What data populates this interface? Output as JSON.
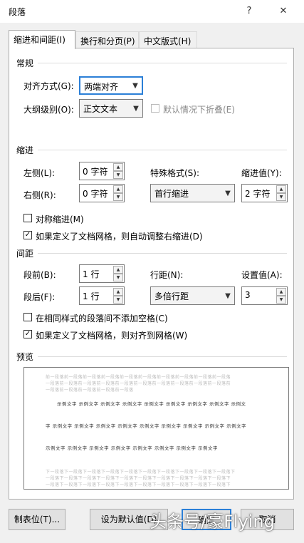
{
  "window": {
    "title": "段落",
    "help": "?",
    "close": "✕"
  },
  "tabs": [
    {
      "label": "缩进和间距(I)"
    },
    {
      "label": "换行和分页(P)"
    },
    {
      "label": "中文版式(H)"
    }
  ],
  "general": {
    "section": "常规",
    "align_label": "对齐方式(G):",
    "align_value": "两端对齐",
    "outline_label": "大纲级别(O):",
    "outline_value": "正文文本",
    "collapse_label": "默认情况下折叠(E)"
  },
  "indent": {
    "section": "缩进",
    "left_label": "左侧(L):",
    "left_value": "0 字符",
    "right_label": "右侧(R):",
    "right_value": "0 字符",
    "special_label": "特殊格式(S):",
    "special_value": "首行缩进",
    "by_label": "缩进值(Y):",
    "by_value": "2 字符",
    "mirror_label": "对称缩进(M)",
    "mirror_checked": false,
    "auto_label": "如果定义了文档网格，则自动调整右缩进(D)",
    "auto_checked": true
  },
  "spacing": {
    "section": "间距",
    "before_label": "段前(B):",
    "before_value": "1 行",
    "after_label": "段后(F):",
    "after_value": "1 行",
    "line_label": "行距(N):",
    "line_value": "多倍行距",
    "at_label": "设置值(A):",
    "at_value": "3",
    "nospace_label": "在相同样式的段落间不添加空格(C)",
    "nospace_checked": false,
    "grid_label": "如果定义了文档网格，则对齐到网格(W)",
    "grid_checked": true
  },
  "preview": {
    "section": "预览",
    "prev_lines": [
      "前一段落前一段落前一段落前一段落前一段落前一段落前一段落前一段落前一段落前一段落",
      "一段落前一段落前一段落前一段落前一段落前一段落前一段落前一段落前一段落前一段落前",
      "一段落前一段落前一段落前一段落前一段落"
    ],
    "sample_lines": [
      "示例文字 示例文字 示例文字 示例文字 示例文字 示例文字 示例文字 示例文字 示例文",
      "字 示例文字 示例文字 示例文字 示例文字 示例文字 示例文字 示例文字 示例文字 示例文字",
      "示例文字 示例文字 示例文字 示例文字 示例文字 示例文字 示例文字 示例文字"
    ],
    "next_lines": [
      "下一段落下一段落下一段落下一段落下一段落下一段落下一段落下一段落下一段落下一段落下",
      "一段落下一段落下一段落下一段落下一段落下一段落下一段落下一段落下一段落下一段落下",
      "一段落下一段落下一段落下一段落下一段落下一段落下一段落下一段落下一段落下一段落下"
    ]
  },
  "buttons": {
    "tabs": "制表位(T)...",
    "default": "设为默认值(D)",
    "ok": "确定",
    "cancel": "取消"
  },
  "watermark": "头条号/豪Flying"
}
